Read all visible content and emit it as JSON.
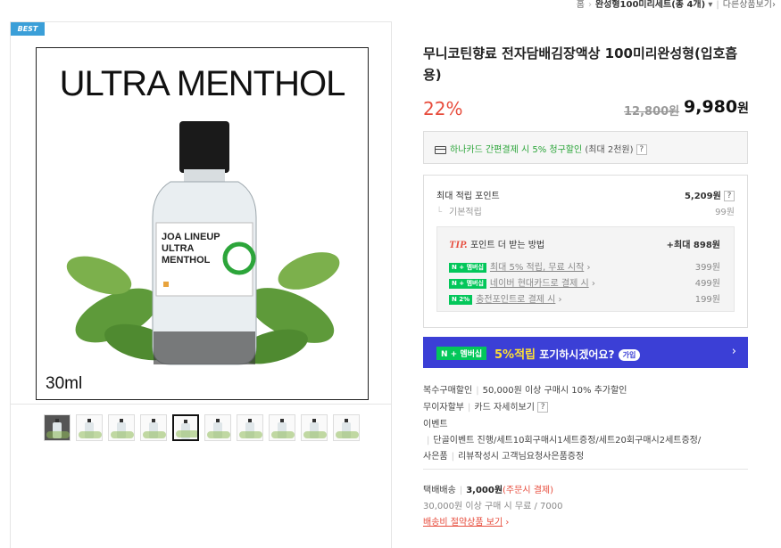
{
  "breadcrumb": {
    "home": "홈",
    "category": "완성형100미리세트(총 4개)",
    "more": "다른상품보기"
  },
  "product": {
    "badge": "BEST",
    "image_title": "ULTRA MENTHOL",
    "image_size": "30ml",
    "label_brand": "JOA LINEUP",
    "label_line1": "ULTRA",
    "label_line2": "MENTHOL",
    "title": "무니코틴향료 전자담배김장액상 100미리완성형(입호흡용)",
    "discount": "22%",
    "original_price": "12,800원",
    "price_number": "9,980",
    "price_unit": "원",
    "thumb_count": 10,
    "thumb_active_index": 4
  },
  "card_promo": {
    "text": "하나카드 간편결제 시 5% 청구할인",
    "note": "(최대 2천원)",
    "help": "?"
  },
  "points": {
    "max_label": "최대 적립 포인트",
    "max_value": "5,209원",
    "help": "?",
    "base_label": "기본적립",
    "base_value": "99원",
    "tip_label": "TIP.",
    "tip_text": "포인트 더 받는 방법",
    "tip_max": "+최대 898원",
    "items": [
      {
        "badge": "N + 멤버십",
        "text": "최대 5% 적립, 무료 시작",
        "amount": "399원"
      },
      {
        "badge": "N + 멤버십",
        "text": "네이버 현대카드로 결제 시",
        "amount": "499원"
      },
      {
        "badge": "N 2%",
        "text": "충전포인트로 결제 시",
        "amount": "199원"
      }
    ]
  },
  "banner": {
    "logo": "N + 멤버십",
    "highlight": "5%적립",
    "text": "포기하시겠어요?",
    "pill": "가입",
    "arrow": "›"
  },
  "details": {
    "bulk_label": "복수구매할인",
    "bulk_value": "50,000원 이상 구매시 10% 추가할인",
    "interest_label": "무이자할부",
    "interest_value": "카드 자세히보기",
    "event_label": "이벤트",
    "event_line1": "단골이벤트 진행/세트10회구매시1세트증정/세트20회구매시2세트증정/",
    "event_line2_a": "사은품",
    "event_line2_b": "리뷰작성시 고객님요청사은품증정"
  },
  "shipping": {
    "label": "택배배송",
    "price": "3,000원",
    "note": "(주문시 결제)",
    "free_info": "30,000원 이상 구매 시 무료 / 7000",
    "link": "배송비 절약상품 보기"
  },
  "colors": {
    "discount": "#e74c3c",
    "naver_green": "#03c75a",
    "banner_blue": "#3b3fd6",
    "badge_blue": "#3b9fd8"
  }
}
